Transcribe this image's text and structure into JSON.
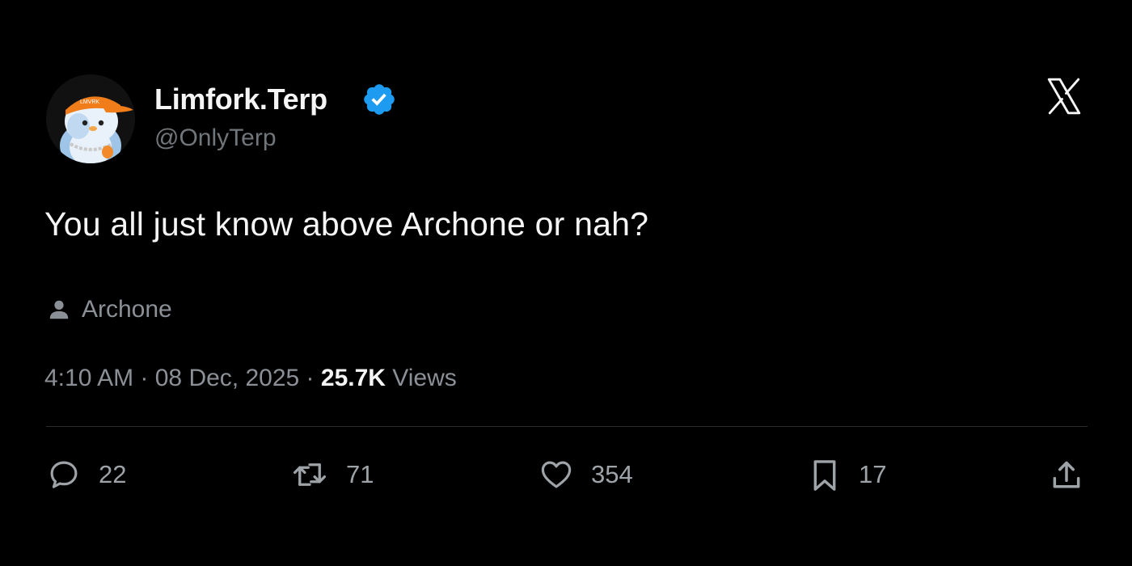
{
  "author": {
    "display_name": "Limfork.Terp",
    "handle": "@OnlyTerp",
    "verified": true,
    "avatar": "penguin-avatar-orange-cap",
    "cap_text": "LMVRK"
  },
  "platform_icon": "x-logo-icon",
  "post": {
    "text": "You all just know above Archone or nah?"
  },
  "community": {
    "icon": "person-icon",
    "label": "Archone"
  },
  "meta": {
    "time": "4:10 AM",
    "separator": " · ",
    "date": "08 Dec, 2025",
    "views_count": "25.7K",
    "views_label": " Views"
  },
  "actions": {
    "replies": "22",
    "reposts": "71",
    "likes": "354",
    "bookmarks": "17"
  },
  "colors": {
    "background": "#000000",
    "verified_badge": "#1d9bf0",
    "secondary_text": "#8b9096",
    "cap_orange": "#f07d1a"
  }
}
